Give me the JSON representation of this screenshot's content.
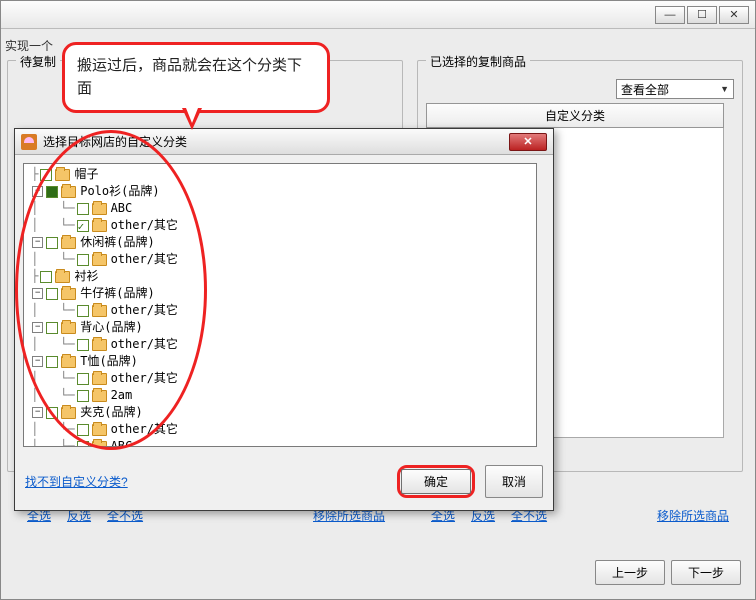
{
  "window": {
    "subtitle": "实现一个",
    "minimize": "—",
    "maximize": "☐",
    "close": "✕"
  },
  "panels": {
    "left_title": "待复制",
    "right_title": "已选择的复制商品",
    "view_all": "查看全部",
    "col_header": "自定义分类"
  },
  "bottom_links": {
    "select_all": "全选",
    "invert": "反选",
    "select_none": "全不选",
    "remove_selected": "移除所选商品"
  },
  "nav": {
    "prev": "上一步",
    "next": "下一步"
  },
  "callout_text": "搬运过后，商品就会在这个分类下面",
  "modal": {
    "title": "选择目标网店的自定义分类",
    "help_link": "找不到自定义分类?",
    "ok": "确定",
    "cancel": "取消",
    "close_glyph": "✕"
  },
  "tree": [
    {
      "depth": 0,
      "exp": null,
      "cb": "unchecked",
      "label": "帽子"
    },
    {
      "depth": 0,
      "exp": "-",
      "cb": "checked",
      "label": "Polo衫(品牌)"
    },
    {
      "depth": 1,
      "exp": null,
      "cb": "unchecked",
      "label": "ABC"
    },
    {
      "depth": 1,
      "exp": null,
      "cb": "tick",
      "label": "other/其它"
    },
    {
      "depth": 0,
      "exp": "-",
      "cb": "unchecked",
      "label": "休闲裤(品牌)"
    },
    {
      "depth": 1,
      "exp": null,
      "cb": "unchecked",
      "label": "other/其它"
    },
    {
      "depth": 0,
      "exp": null,
      "cb": "unchecked",
      "label": "衬衫"
    },
    {
      "depth": 0,
      "exp": "-",
      "cb": "unchecked",
      "label": "牛仔裤(品牌)"
    },
    {
      "depth": 1,
      "exp": null,
      "cb": "unchecked",
      "label": "other/其它"
    },
    {
      "depth": 0,
      "exp": "-",
      "cb": "unchecked",
      "label": "背心(品牌)"
    },
    {
      "depth": 1,
      "exp": null,
      "cb": "unchecked",
      "label": "other/其它"
    },
    {
      "depth": 0,
      "exp": "-",
      "cb": "unchecked",
      "label": "T恤(品牌)"
    },
    {
      "depth": 1,
      "exp": null,
      "cb": "unchecked",
      "label": "other/其它"
    },
    {
      "depth": 1,
      "exp": null,
      "cb": "unchecked",
      "label": "2am"
    },
    {
      "depth": 0,
      "exp": "-",
      "cb": "unchecked",
      "label": "夹克(品牌)"
    },
    {
      "depth": 1,
      "exp": null,
      "cb": "unchecked",
      "label": "other/其它"
    },
    {
      "depth": 1,
      "exp": null,
      "cb": "unchecked",
      "label": "ABC"
    }
  ]
}
